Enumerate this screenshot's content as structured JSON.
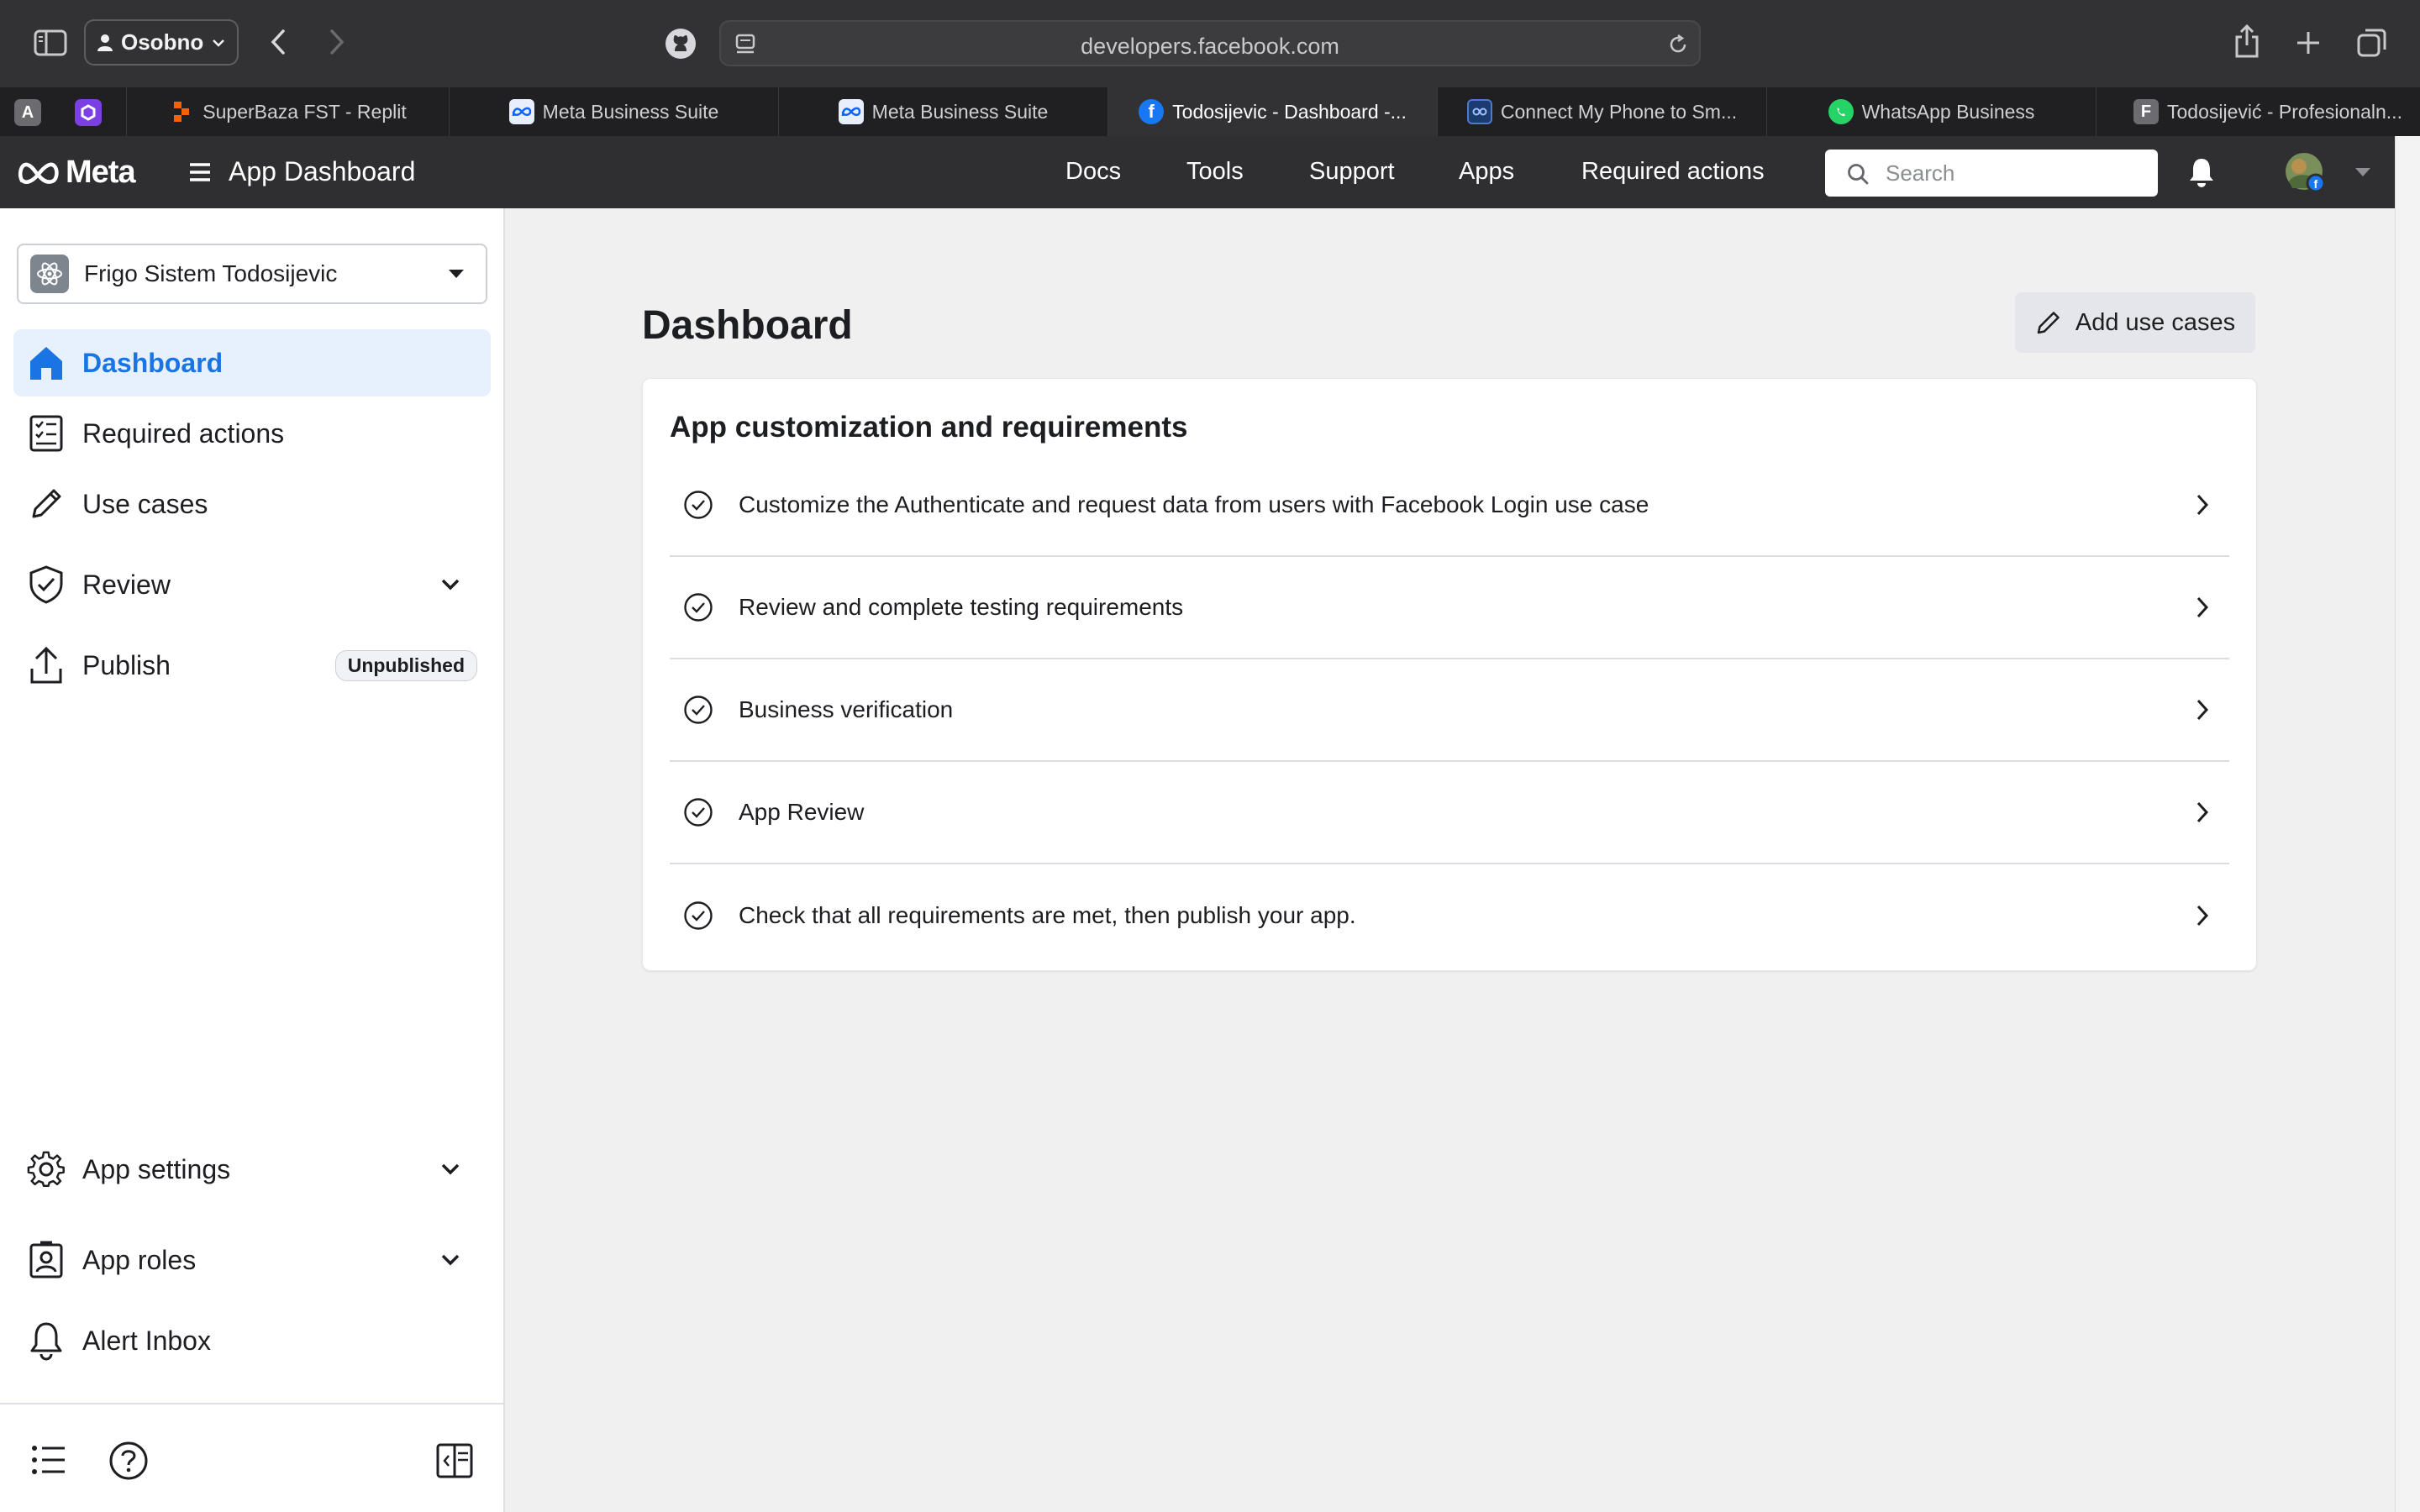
{
  "browser": {
    "profile_label": "Osobno",
    "url": "developers.facebook.com",
    "tabs": [
      {
        "label": "SuperBaza FST - Replit"
      },
      {
        "label": "Meta Business Suite"
      },
      {
        "label": "Meta Business Suite"
      },
      {
        "label": "Todosijevic - Dashboard -..."
      },
      {
        "label": "Connect My Phone to Sm..."
      },
      {
        "label": "WhatsApp Business"
      },
      {
        "label": "Todosijević - Profesionaln..."
      }
    ],
    "pinned_tabs": [
      {
        "letter": "A"
      }
    ]
  },
  "meta_nav": {
    "logo_text": "Meta",
    "title": "App Dashboard",
    "links": [
      "Docs",
      "Tools",
      "Support",
      "Apps",
      "Required actions"
    ],
    "search_placeholder": "Search"
  },
  "sidebar": {
    "app_name": "Frigo Sistem Todosijevic",
    "items": [
      {
        "label": "Dashboard",
        "icon": "home-icon",
        "active": true
      },
      {
        "label": "Required actions",
        "icon": "checklist-icon"
      },
      {
        "label": "Use cases",
        "icon": "pencil-icon"
      },
      {
        "label": "Review",
        "icon": "shield-check-icon"
      },
      {
        "label": "Publish",
        "icon": "upload-icon",
        "badge": "Unpublished"
      }
    ],
    "bottom_items": [
      {
        "label": "App settings",
        "icon": "gear-icon"
      },
      {
        "label": "App roles",
        "icon": "id-badge-icon"
      },
      {
        "label": "Alert Inbox",
        "icon": "bell-icon"
      }
    ]
  },
  "main": {
    "title": "Dashboard",
    "add_button_label": "Add use cases",
    "card_title": "App customization and requirements",
    "requirements": [
      {
        "label": "Customize the Authenticate and request data from users with Facebook Login use case"
      },
      {
        "label": "Review and complete testing requirements"
      },
      {
        "label": "Business verification"
      },
      {
        "label": "App Review"
      },
      {
        "label": "Check that all requirements are met, then publish your app."
      }
    ]
  },
  "colors": {
    "accent": "#1b74e4",
    "nav_bg": "#2f2f31",
    "browser_bg": "#323235",
    "page_bg": "#f0f0f0"
  }
}
